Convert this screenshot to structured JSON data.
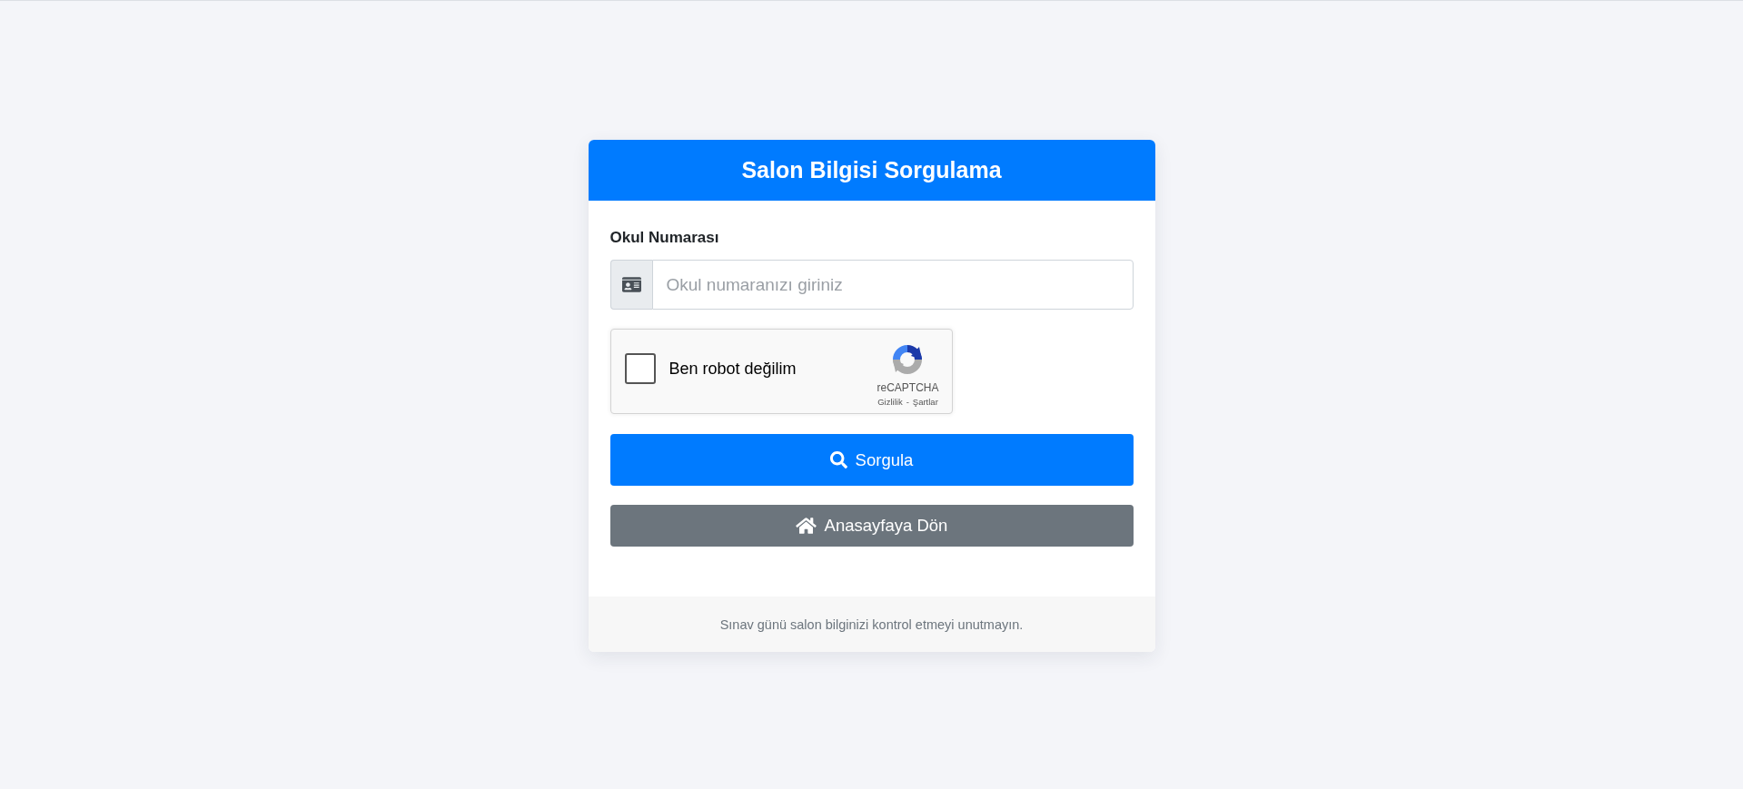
{
  "card": {
    "title": "Salon Bilgisi Sorgulama"
  },
  "form": {
    "field": {
      "label": "Okul Numarası",
      "placeholder": "Okul numaranızı giriniz"
    },
    "captcha": {
      "label": "Ben robot değilim",
      "checked": false,
      "brand": "reCAPTCHA",
      "links": [
        "Gizlilik",
        "Şartlar"
      ],
      "separator": "-"
    },
    "buttons": [
      {
        "kind": "primary",
        "label": "Sorgula"
      },
      {
        "kind": "secondary",
        "label": "Anasayfaya Dön"
      }
    ]
  },
  "footer": {
    "text": "Sınav günü salon bilginizi kontrol etmeyi unutmayın."
  }
}
